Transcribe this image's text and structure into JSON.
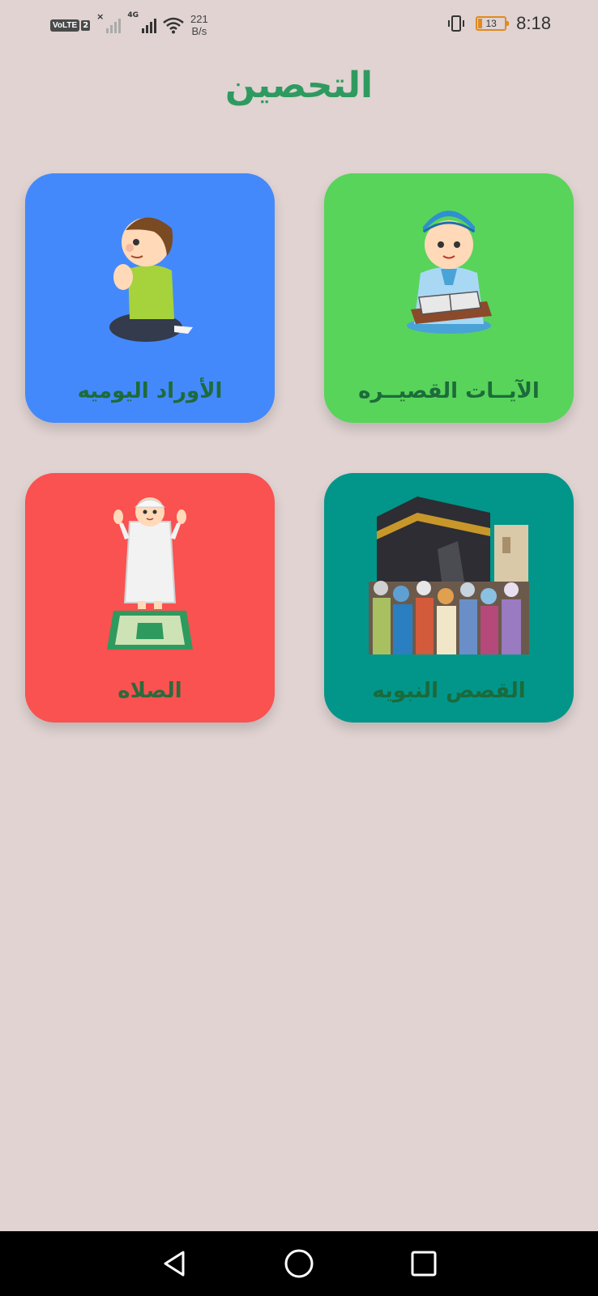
{
  "status_bar": {
    "volte": "VoLTE",
    "sim": "2",
    "network_type": "4G",
    "speed_value": "221",
    "speed_unit": "B/s",
    "battery_level": "13",
    "time": "8:18"
  },
  "page": {
    "title": "التحصين"
  },
  "cards": [
    {
      "label": "الآيــات القصيــره",
      "color": "#58d45a",
      "icon": "boy-reading-quran-icon"
    },
    {
      "label": "الأوراد اليوميه",
      "color": "#4489fb",
      "icon": "boy-praying-dua-icon"
    },
    {
      "label": "القصص النبويه",
      "color": "#02968a",
      "icon": "kaaba-crowd-icon"
    },
    {
      "label": "الصلاه",
      "color": "#fa5151",
      "icon": "boy-prayer-mat-icon"
    }
  ],
  "nav_bar": {
    "back": "back-icon",
    "home": "home-icon",
    "recents": "recents-icon"
  }
}
